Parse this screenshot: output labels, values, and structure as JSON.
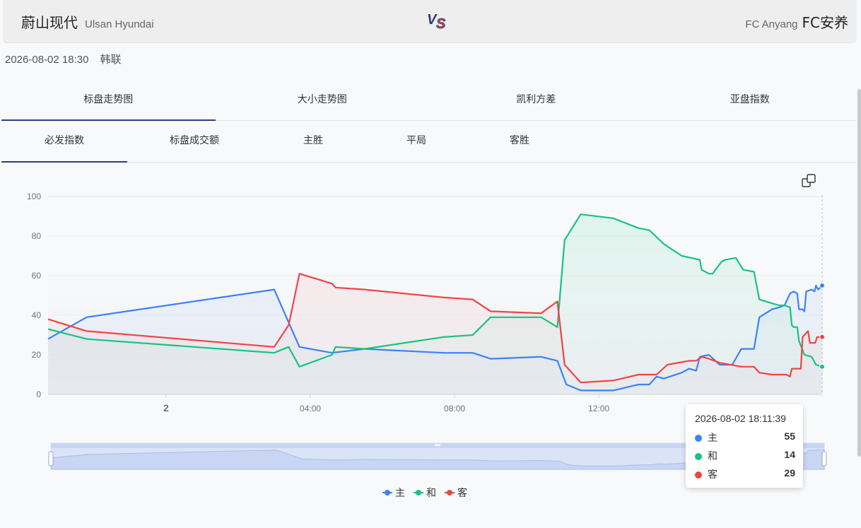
{
  "match": {
    "home_cn": "蔚山现代",
    "home_en": "Ulsan Hyundai",
    "away_en": "FC Anyang",
    "away_cn": "FC安养",
    "datetime": "2026-08-02 18:30",
    "league": "韩联"
  },
  "tabs_main": [
    "标盘走势图",
    "大小走势图",
    "凯利方差",
    "亚盘指数"
  ],
  "tabs_sub": [
    "必发指数",
    "标盘成交额",
    "主胜",
    "平局",
    "客胜"
  ],
  "colors": {
    "home": "#3b82f6",
    "draw": "#16c47f",
    "away": "#ef4444",
    "accent": "#2f3e7d"
  },
  "tooltip": {
    "time": "2026-08-02 18:11:39",
    "rows": [
      {
        "label": "主",
        "value": "55"
      },
      {
        "label": "和",
        "value": "14"
      },
      {
        "label": "客",
        "value": "29"
      }
    ]
  },
  "legend": [
    "主",
    "和",
    "客"
  ],
  "chart_data": {
    "type": "area",
    "ylim": [
      0,
      100
    ],
    "y_ticks": [
      "0",
      "20",
      "40",
      "60",
      "80",
      "100"
    ],
    "x_ticks": [
      {
        "label": "2",
        "t": 0
      },
      {
        "label": "04:00",
        "t": 4
      },
      {
        "label": "08:00",
        "t": 8
      },
      {
        "label": "12:00",
        "t": 12
      }
    ],
    "x_range_hours": [
      -3.27,
      18.19
    ],
    "series": [
      {
        "name": "主",
        "color": "#3b82f6",
        "points": [
          [
            -3.27,
            28
          ],
          [
            -2.2,
            39
          ],
          [
            3.0,
            53
          ],
          [
            3.7,
            24
          ],
          [
            4.6,
            21
          ],
          [
            5.5,
            23
          ],
          [
            7.7,
            21
          ],
          [
            8.5,
            21
          ],
          [
            9.0,
            18
          ],
          [
            10.4,
            19
          ],
          [
            10.85,
            17
          ],
          [
            11.1,
            5
          ],
          [
            11.5,
            2
          ],
          [
            12.4,
            2
          ],
          [
            13.1,
            5
          ],
          [
            13.4,
            5
          ],
          [
            13.6,
            9
          ],
          [
            13.8,
            8
          ],
          [
            14.3,
            11
          ],
          [
            14.5,
            13
          ],
          [
            14.7,
            12
          ],
          [
            14.8,
            19
          ],
          [
            15.05,
            20
          ],
          [
            15.35,
            15
          ],
          [
            15.7,
            15
          ],
          [
            15.95,
            23
          ],
          [
            16.3,
            23
          ],
          [
            16.45,
            39
          ],
          [
            16.8,
            43
          ],
          [
            17.0,
            44
          ],
          [
            17.15,
            45
          ],
          [
            17.3,
            51
          ],
          [
            17.4,
            52
          ],
          [
            17.5,
            51
          ],
          [
            17.55,
            43
          ],
          [
            17.65,
            43
          ],
          [
            17.7,
            42
          ],
          [
            17.75,
            52
          ],
          [
            17.9,
            53
          ],
          [
            17.98,
            52
          ],
          [
            18.02,
            55
          ],
          [
            18.08,
            53
          ],
          [
            18.19,
            55
          ]
        ]
      },
      {
        "name": "和",
        "color": "#16c47f",
        "points": [
          [
            -3.27,
            33
          ],
          [
            -2.2,
            28
          ],
          [
            3.0,
            21
          ],
          [
            3.4,
            24
          ],
          [
            3.7,
            14
          ],
          [
            4.6,
            20
          ],
          [
            4.7,
            24
          ],
          [
            5.5,
            23
          ],
          [
            7.7,
            29
          ],
          [
            8.5,
            30
          ],
          [
            9.0,
            39
          ],
          [
            10.4,
            39
          ],
          [
            10.85,
            34
          ],
          [
            11.05,
            78
          ],
          [
            11.5,
            91
          ],
          [
            12.4,
            89
          ],
          [
            13.1,
            84
          ],
          [
            13.4,
            83
          ],
          [
            13.8,
            76
          ],
          [
            14.3,
            70
          ],
          [
            14.8,
            68
          ],
          [
            14.85,
            63
          ],
          [
            15.05,
            61
          ],
          [
            15.15,
            61
          ],
          [
            15.4,
            67
          ],
          [
            15.5,
            68
          ],
          [
            15.8,
            69
          ],
          [
            16.0,
            63
          ],
          [
            16.3,
            62
          ],
          [
            16.45,
            48
          ],
          [
            16.8,
            46
          ],
          [
            17.0,
            45
          ],
          [
            17.15,
            45
          ],
          [
            17.3,
            44
          ],
          [
            17.35,
            35
          ],
          [
            17.4,
            34
          ],
          [
            17.5,
            34
          ],
          [
            17.55,
            27
          ],
          [
            17.7,
            20
          ],
          [
            17.9,
            19
          ],
          [
            18.02,
            15
          ],
          [
            18.19,
            14
          ]
        ]
      },
      {
        "name": "客",
        "color": "#ef4444",
        "points": [
          [
            -3.27,
            38
          ],
          [
            -2.2,
            32
          ],
          [
            3.0,
            24
          ],
          [
            3.4,
            35
          ],
          [
            3.7,
            61
          ],
          [
            4.6,
            56
          ],
          [
            4.7,
            54
          ],
          [
            5.5,
            53
          ],
          [
            7.7,
            49
          ],
          [
            8.5,
            48
          ],
          [
            9.0,
            42
          ],
          [
            10.4,
            41
          ],
          [
            10.85,
            47
          ],
          [
            11.05,
            15
          ],
          [
            11.5,
            6
          ],
          [
            12.4,
            7
          ],
          [
            13.1,
            10
          ],
          [
            13.6,
            10
          ],
          [
            13.9,
            15
          ],
          [
            14.5,
            17
          ],
          [
            14.7,
            17
          ],
          [
            14.85,
            19
          ],
          [
            15.05,
            18
          ],
          [
            15.35,
            16
          ],
          [
            15.95,
            14
          ],
          [
            16.3,
            14
          ],
          [
            16.45,
            11
          ],
          [
            16.8,
            10
          ],
          [
            17.2,
            10
          ],
          [
            17.3,
            9
          ],
          [
            17.35,
            13
          ],
          [
            17.6,
            13
          ],
          [
            17.65,
            29
          ],
          [
            17.8,
            32
          ],
          [
            17.85,
            26
          ],
          [
            18.0,
            26
          ],
          [
            18.05,
            29
          ],
          [
            18.19,
            29
          ]
        ]
      }
    ]
  }
}
